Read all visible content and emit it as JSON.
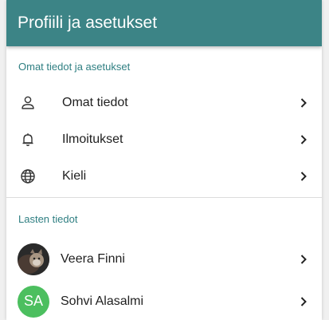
{
  "header": {
    "title": "Profiili ja asetukset"
  },
  "sections": {
    "own": {
      "title": "Omat tiedot ja asetukset",
      "items": [
        {
          "label": "Omat tiedot",
          "icon": "person-icon"
        },
        {
          "label": "Ilmoitukset",
          "icon": "bell-icon"
        },
        {
          "label": "Kieli",
          "icon": "globe-icon"
        }
      ]
    },
    "children": {
      "title": "Lasten tiedot",
      "items": [
        {
          "name": "Veera Finni",
          "avatar": "photo"
        },
        {
          "name": "Sohvi Alasalmi",
          "initials": "SA",
          "avatar_color": "#4cbf5f"
        }
      ]
    }
  },
  "colors": {
    "header_bg": "#3c8486",
    "section_title": "#2f7f82"
  }
}
